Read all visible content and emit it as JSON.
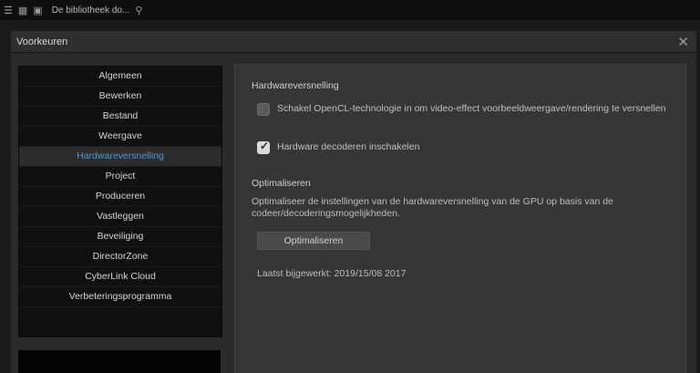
{
  "topbar": {
    "breadcrumb": "De bibliotheek do..."
  },
  "dialog": {
    "title": "Voorkeuren"
  },
  "sidebar": {
    "items": [
      {
        "label": "Algemeen"
      },
      {
        "label": "Bewerken"
      },
      {
        "label": "Bestand"
      },
      {
        "label": "Weergave"
      },
      {
        "label": "Hardwareversnelling"
      },
      {
        "label": "Project"
      },
      {
        "label": "Produceren"
      },
      {
        "label": "Vastleggen"
      },
      {
        "label": "Beveiliging"
      },
      {
        "label": "DirectorZone"
      },
      {
        "label": "CyberLink Cloud"
      },
      {
        "label": "Verbeteringsprogramma"
      }
    ],
    "active_index": 4
  },
  "content": {
    "hw_section_title": "Hardwareversnelling",
    "opengl": {
      "label": "Schakel OpenCL-technologie in om video-effect voorbeeldweergave/rendering te versnellen",
      "checked": false
    },
    "hw_decode": {
      "label": "Hardware decoderen inschakelen",
      "checked": true
    },
    "opt_section_title": "Optimaliseren",
    "opt_description": "Optimaliseer de instellingen van de hardwareversnelling van de GPU op basis van de codeer/decoderingsmogelijkheden.",
    "opt_button": "Optimaliseren",
    "last_optimized": "Laatst bijgewerkt: 2019/15/08 2017"
  },
  "colors": {
    "accent": "#4f96d8",
    "panel": "#363636",
    "background": "#1b1b1b"
  },
  "icons": [
    "menu-icon",
    "grid-icon",
    "library-icon",
    "search-icon",
    "close-icon",
    "checkmark-icon"
  ]
}
